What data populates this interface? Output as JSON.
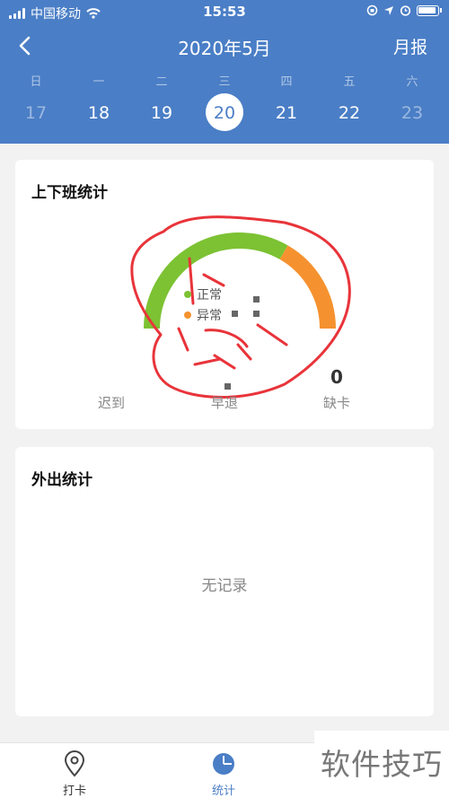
{
  "status_bar": {
    "carrier": "中国移动",
    "time": "15:53"
  },
  "nav": {
    "title": "2020年5月",
    "right_label": "月报"
  },
  "week": {
    "weekdays": [
      "日",
      "一",
      "二",
      "三",
      "四",
      "五",
      "六"
    ],
    "dates": [
      "17",
      "18",
      "19",
      "20",
      "21",
      "22",
      "23"
    ],
    "selected": "20"
  },
  "attendance": {
    "title": "上下班统计",
    "legend": [
      {
        "label": "正常",
        "color": "#7cc233"
      },
      {
        "label": "异常",
        "color": "#f5922f"
      }
    ],
    "stats": [
      {
        "label": "迟到",
        "value": ""
      },
      {
        "label": "早退",
        "value": ""
      },
      {
        "label": "缺卡",
        "value": "0"
      }
    ]
  },
  "outing": {
    "title": "外出统计",
    "empty": "无记录"
  },
  "tabs": [
    {
      "label": "打卡",
      "icon": "location-pin-icon"
    },
    {
      "label": "统计",
      "icon": "pie-chart-icon"
    }
  ],
  "watermark": "软件技巧",
  "colors": {
    "primary": "#4a7ec6",
    "normal": "#7cc233",
    "abnormal": "#f5922f",
    "annotation": "#e8343a"
  },
  "chart_data": {
    "type": "pie",
    "title": "",
    "categories": [
      "正常",
      "异常"
    ],
    "values": [
      2,
      1
    ],
    "legend_position": "center"
  }
}
